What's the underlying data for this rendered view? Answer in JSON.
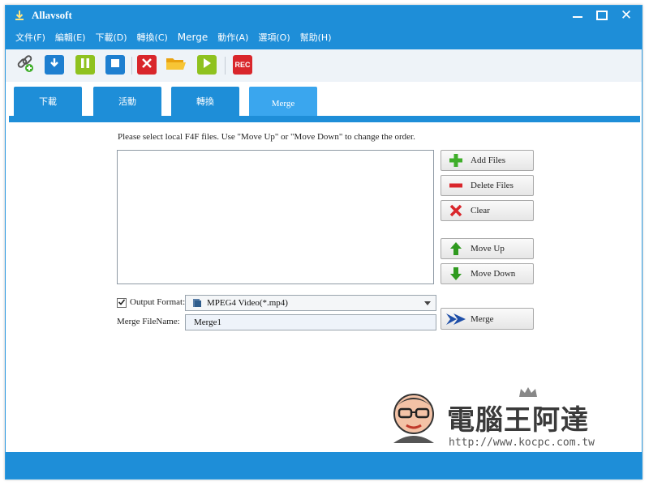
{
  "app": {
    "title": "Allavsoft",
    "icon": "download-arrow-icon"
  },
  "window_controls": {
    "minimize": "minimize-icon",
    "maximize": "maximize-icon",
    "close_glyph": "✕"
  },
  "menu": [
    {
      "label": "文件(F)"
    },
    {
      "label": "編輯(E)"
    },
    {
      "label": "下載(D)"
    },
    {
      "label": "轉換(C)"
    },
    {
      "label": "Merge"
    },
    {
      "label": "動作(A)"
    },
    {
      "label": "選項(O)"
    },
    {
      "label": "幫助(H)"
    }
  ],
  "toolbar": {
    "buttons": [
      {
        "icon": "paste-link-icon"
      },
      {
        "icon": "download-icon"
      },
      {
        "icon": "pause-icon"
      },
      {
        "icon": "stop-icon"
      },
      {
        "icon": "delete-icon"
      },
      {
        "icon": "folder-icon"
      },
      {
        "icon": "play-icon"
      },
      {
        "icon": "record-icon",
        "text": "REC"
      }
    ]
  },
  "tabs": [
    {
      "label": "下載"
    },
    {
      "label": "活動"
    },
    {
      "label": "轉換"
    },
    {
      "label": "Merge",
      "active": true
    }
  ],
  "merge": {
    "instruction": "Please select local F4F files. Use \"Move Up\" or \"Move Down\" to change the order.",
    "buttons": {
      "add_files": "Add Files",
      "delete_files": "Delete Files",
      "clear": "Clear",
      "move_up": "Move Up",
      "move_down": "Move Down",
      "merge": "Merge"
    },
    "output_format_label": "Output Format:",
    "output_format_checked": true,
    "output_format_value": "MPEG4 Video(*.mp4)",
    "filename_label": "Merge FileName:",
    "filename_value": "Merge1"
  },
  "watermark": {
    "title": "電腦王阿達",
    "url": "http://www.kocpc.com.tw"
  },
  "colors": {
    "accent": "#1e8ed8",
    "tab_active": "#3aa6ee",
    "green": "#3fae2a",
    "red": "#d9262b",
    "blue_btn": "#1e7fd0",
    "folder": "#f2b21b"
  }
}
